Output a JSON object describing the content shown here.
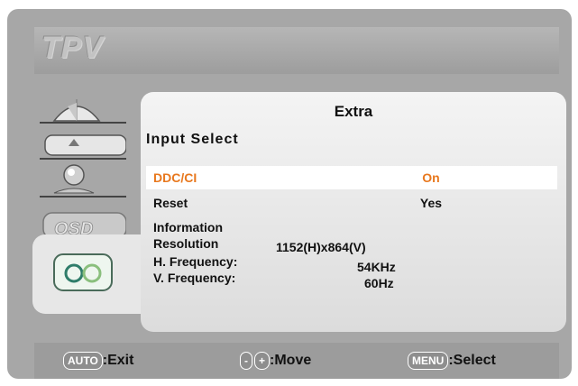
{
  "brand": "TPV",
  "panel": {
    "title": "Extra",
    "section": "Input Select"
  },
  "rows": [
    {
      "label": "DDC/CI",
      "value": "On",
      "selected": true
    },
    {
      "label": "Reset",
      "value": "Yes",
      "selected": false
    }
  ],
  "information": {
    "heading": "Information",
    "resolution_label": "Resolution",
    "resolution_value": "1152(H)x864(V)",
    "hfreq_label": "H. Frequency:",
    "hfreq_value": "54KHz",
    "vfreq_label": "V. Frequency:",
    "vfreq_value": "60Hz"
  },
  "footer": {
    "auto_key": "AUTO",
    "exit_label": ":Exit",
    "minus_key": "-",
    "plus_key": "+",
    "move_label": ":Move",
    "menu_key": "MENU",
    "select_label": ":Select"
  },
  "tabs": [
    {
      "icon": "luminance-icon"
    },
    {
      "icon": "image-setup-icon"
    },
    {
      "icon": "color-temperature-icon"
    },
    {
      "icon": "osd-setup-icon"
    },
    {
      "icon": "extra-icon"
    }
  ],
  "colors": {
    "selected_text": "#e8781e",
    "osd_background": "#a7a7a7"
  }
}
